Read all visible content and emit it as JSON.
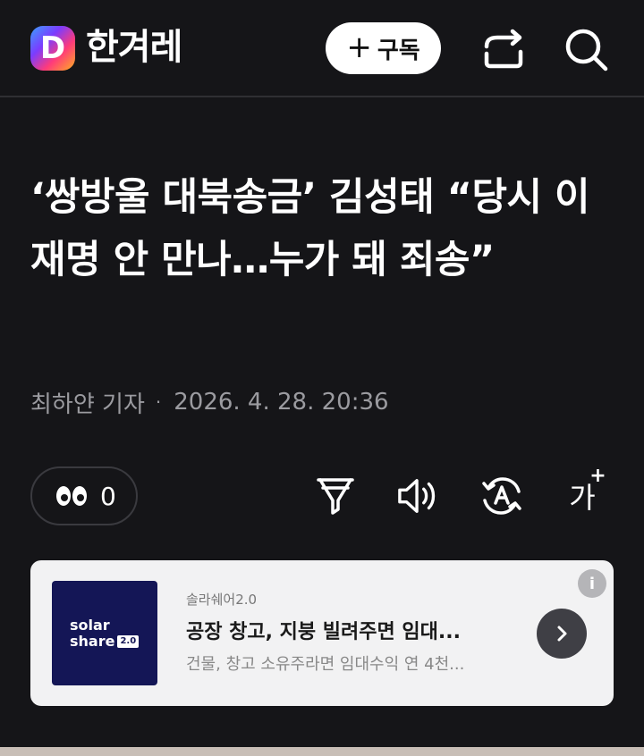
{
  "header": {
    "logo_letter": "D",
    "brand": "한겨레",
    "subscribe_plus": "+",
    "subscribe_label": "구독",
    "share_icon": "share-arrow-icon",
    "search_icon": "search-icon"
  },
  "article": {
    "headline": "‘쌍방울 대북송금’ 김성태 “당시 이재명 안 만나…누가 돼 죄송”",
    "author": "최하얀 기자",
    "separator": "·",
    "datetime": "2026. 4. 28. 20:36"
  },
  "toolbar": {
    "views_icon": "eyes-icon",
    "views_count": "0",
    "filter_icon": "filter-icon",
    "audio_icon": "speaker-icon",
    "translate_icon": "translate-icon",
    "fontsize_label": "가",
    "fontsize_plus": "+"
  },
  "ad": {
    "thumb_line1": "solar",
    "thumb_line2": "share",
    "thumb_badge": "2.0",
    "sponsor": "솔라쉐어2.0",
    "title": "공장 창고, 지붕 빌려주면 임대...",
    "description": "건물, 창고 소유주라면 임대수익 연 4천...",
    "info_label": "i"
  },
  "colors": {
    "background": "#151518",
    "ad_background": "#f2f2f3",
    "ad_thumb": "#141656"
  }
}
